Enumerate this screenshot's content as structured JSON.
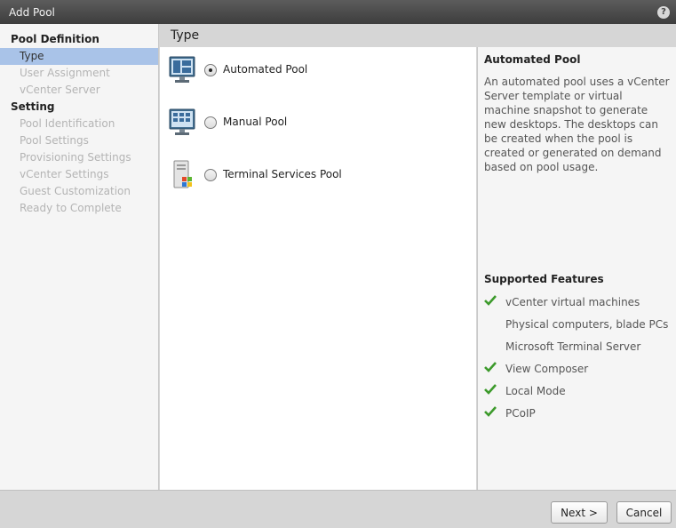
{
  "window": {
    "title": "Add Pool",
    "help_glyph": "?"
  },
  "sidebar": {
    "sections": [
      {
        "heading": "Pool Definition",
        "items": [
          "Type",
          "User Assignment",
          "vCenter Server"
        ]
      },
      {
        "heading": "Setting",
        "items": [
          "Pool Identification",
          "Pool Settings",
          "Provisioning Settings",
          "vCenter Settings",
          "Guest Customization",
          "Ready to Complete"
        ]
      }
    ],
    "active_item": "Type"
  },
  "main": {
    "header": "Type",
    "options": [
      {
        "label": "Automated Pool",
        "icon": "automated-pool-icon",
        "selected": true
      },
      {
        "label": "Manual Pool",
        "icon": "manual-pool-icon",
        "selected": false
      },
      {
        "label": "Terminal Services Pool",
        "icon": "terminal-server-icon",
        "selected": false
      }
    ]
  },
  "info": {
    "title": "Automated Pool",
    "description": "An automated pool uses a vCenter Server template or virtual machine snapshot to generate new desktops. The desktops can be created when the pool is created or generated on demand based on pool usage.",
    "features_title": "Supported Features",
    "features": [
      {
        "label": "vCenter virtual machines",
        "supported": true
      },
      {
        "label": "Physical computers, blade PCs",
        "supported": false
      },
      {
        "label": "Microsoft Terminal Server",
        "supported": false
      },
      {
        "label": "View Composer",
        "supported": true
      },
      {
        "label": "Local Mode",
        "supported": true
      },
      {
        "label": "PCoIP",
        "supported": true
      }
    ]
  },
  "footer": {
    "next_label": "Next >",
    "cancel_label": "Cancel"
  },
  "colors": {
    "active_item_bg": "#a9c3e8",
    "check_green": "#3c9a2b",
    "titlebar": "#4a4a4a"
  }
}
